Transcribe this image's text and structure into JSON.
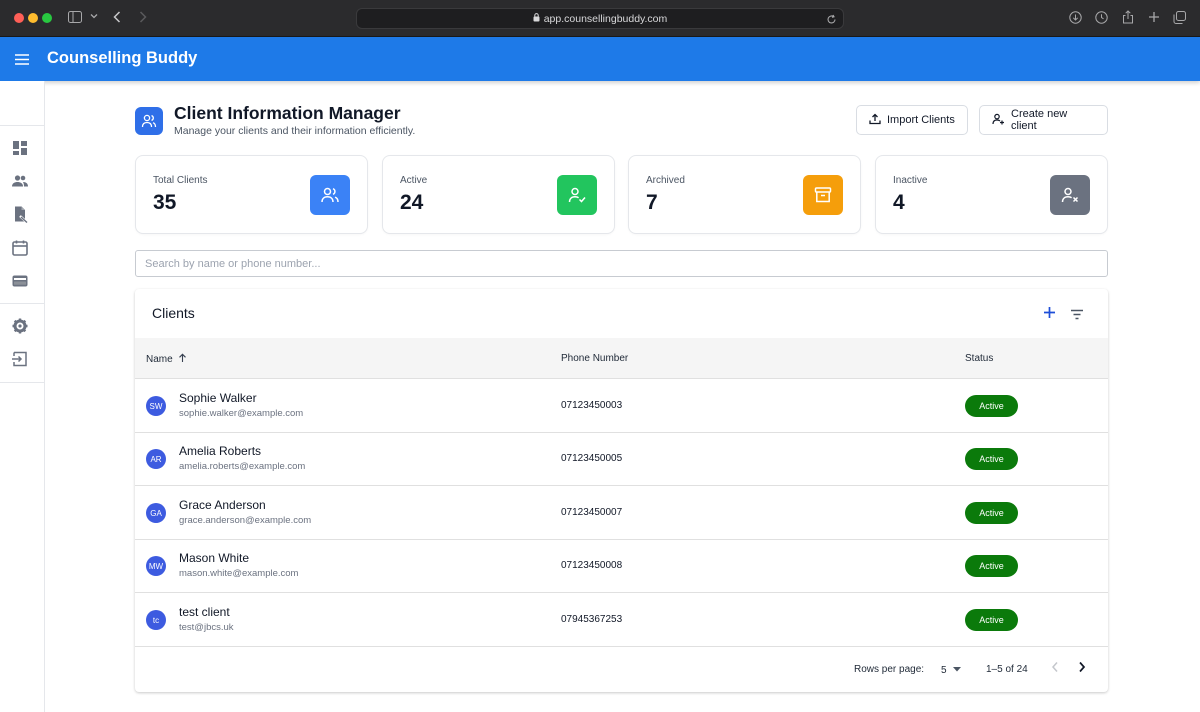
{
  "browser": {
    "url": "app.counsellingbuddy.com"
  },
  "app": {
    "title": "Counselling Buddy"
  },
  "sidebar": {
    "items": [
      {
        "icon": "dashboard-icon"
      },
      {
        "icon": "people-icon"
      },
      {
        "icon": "document-icon"
      },
      {
        "icon": "calendar-icon"
      },
      {
        "icon": "wallet-icon"
      },
      {
        "icon": "gear-icon"
      },
      {
        "icon": "logout-icon"
      }
    ]
  },
  "page": {
    "title": "Client Information Manager",
    "subtitle": "Manage your clients and their information efficiently.",
    "import_label": "Import Clients",
    "create_label": "Create new client"
  },
  "stats": [
    {
      "label": "Total Clients",
      "value": "35",
      "color": "#3b82f6",
      "icon": "users-icon"
    },
    {
      "label": "Active",
      "value": "24",
      "color": "#22c55e",
      "icon": "user-check-icon"
    },
    {
      "label": "Archived",
      "value": "7",
      "color": "#f59e0b",
      "icon": "archive-icon"
    },
    {
      "label": "Inactive",
      "value": "4",
      "color": "#6b7280",
      "icon": "user-x-icon"
    }
  ],
  "search": {
    "placeholder": "Search by name or phone number..."
  },
  "table": {
    "title": "Clients",
    "columns": {
      "name": "Name",
      "phone": "Phone Number",
      "status": "Status"
    },
    "rows": [
      {
        "initials": "SW",
        "name": "Sophie Walker",
        "email": "sophie.walker@example.com",
        "phone": "07123450003",
        "status": "Active"
      },
      {
        "initials": "AR",
        "name": "Amelia Roberts",
        "email": "amelia.roberts@example.com",
        "phone": "07123450005",
        "status": "Active"
      },
      {
        "initials": "GA",
        "name": "Grace Anderson",
        "email": "grace.anderson@example.com",
        "phone": "07123450007",
        "status": "Active"
      },
      {
        "initials": "MW",
        "name": "Mason White",
        "email": "mason.white@example.com",
        "phone": "07123450008",
        "status": "Active"
      },
      {
        "initials": "tc",
        "name": "test client",
        "email": "test@jbcs.uk",
        "phone": "07945367253",
        "status": "Active"
      }
    ],
    "status_color": "#0b7a0b",
    "pagination": {
      "rows_per_page_label": "Rows per page:",
      "rows_per_page": "5",
      "range": "1–5 of 24"
    }
  }
}
